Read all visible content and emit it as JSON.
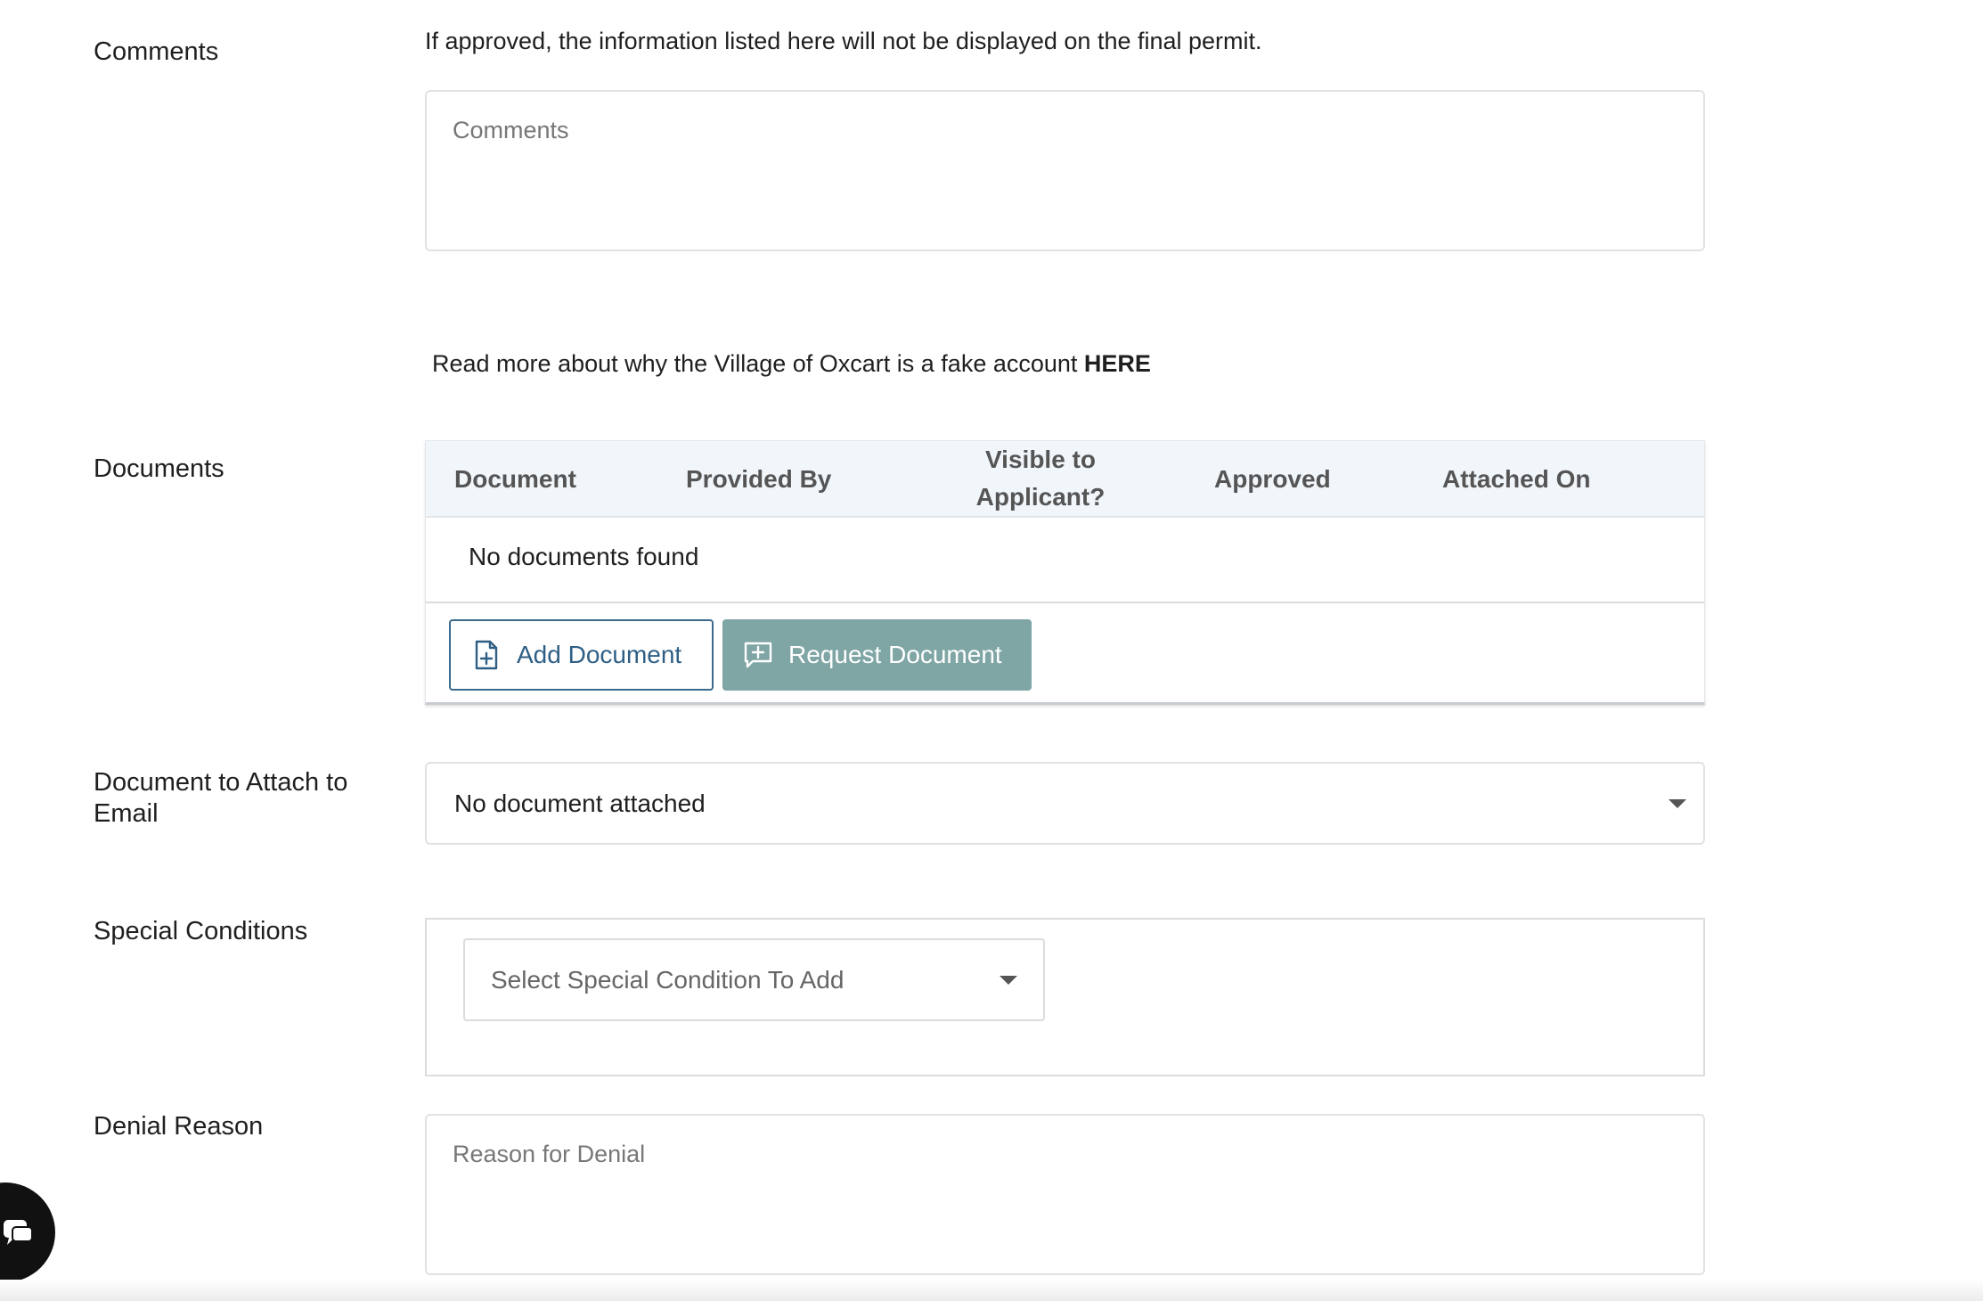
{
  "comments": {
    "label": "Comments",
    "note": "If approved, the information listed here will not be displayed on the final permit.",
    "placeholder": "Comments"
  },
  "read_more": {
    "text": "Read more about why the Village of Oxcart is a fake account ",
    "link": "HERE"
  },
  "documents": {
    "label": "Documents",
    "columns": {
      "document": "Document",
      "provided_by": "Provided By",
      "visible_line1": "Visible to",
      "visible_line2": "Applicant?",
      "approved": "Approved",
      "attached_on": "Attached On"
    },
    "empty_text": "No documents found",
    "add_button": "Add Document",
    "request_button": "Request Document"
  },
  "email_attachment": {
    "label": "Document to Attach to Email",
    "selected": "No document attached"
  },
  "special_conditions": {
    "label": "Special Conditions",
    "placeholder": "Select Special Condition To Add"
  },
  "denial": {
    "label": "Denial Reason",
    "placeholder": "Reason for Denial"
  },
  "icons": {
    "add_document": "file-plus-icon",
    "request_document": "message-plus-icon",
    "dropdown": "chevron-down-icon",
    "chat": "chat-icon"
  },
  "colors": {
    "outline_button": "#2f5f85",
    "request_button_bg": "#7fa5a5",
    "table_header_bg": "#f1f6fb"
  }
}
